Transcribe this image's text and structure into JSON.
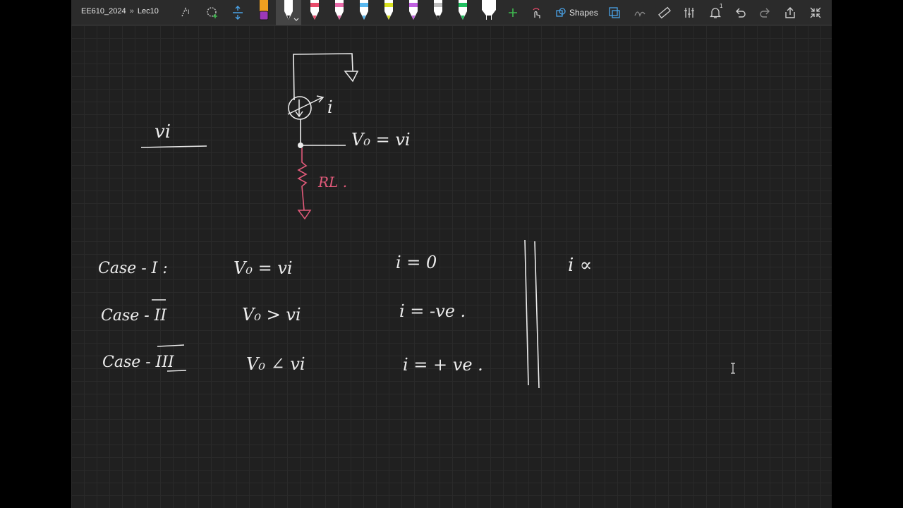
{
  "app": {
    "breadcrumb": {
      "notebook": "EE610_2024",
      "separator": "»",
      "page": "Lec10"
    },
    "toolbar": {
      "shapes_label": "Shapes",
      "notification_count": "1",
      "pen_colors": [
        "#f0a020",
        "#ffffff",
        "#e84a6a",
        "#e86aa8",
        "#58b8f0",
        "#d8e020",
        "#c060e0",
        "#ffffff",
        "#20c060",
        "#ffffff"
      ],
      "pen_tray_colors": [
        "#9b38b8",
        "#ffffff"
      ],
      "icons": [
        "lasso-select-icon",
        "add-space-icon",
        "pen-icon",
        "add-pen-icon",
        "touch-draw-icon",
        "shapes-icon",
        "convert-ink-icon",
        "ink-to-math-icon",
        "ruler-icon",
        "eraser-icon",
        "notification-icon",
        "undo-icon",
        "redo-icon",
        "share-icon",
        "fullscreen-icon"
      ]
    }
  },
  "notes": {
    "input_label": "vi",
    "output_label": "V₀ = vi",
    "current_label": "i",
    "resistor_label": "RL .",
    "cases": [
      {
        "case": "Case - I :",
        "relation": "V₀ = vi",
        "current": "i = 0"
      },
      {
        "case": "Case - II",
        "relation": "V₀ > vi",
        "current": "i = -ve ."
      },
      {
        "case": "Case - III",
        "relation": "V₀ ∠ vi",
        "current": "i =  + ve ."
      }
    ],
    "proportional": "i ∝"
  },
  "colors": {
    "ink_white": "#ececec",
    "ink_pink": "#e25a7a",
    "canvas": "#202020",
    "toolbar": "#2b2b2b"
  }
}
